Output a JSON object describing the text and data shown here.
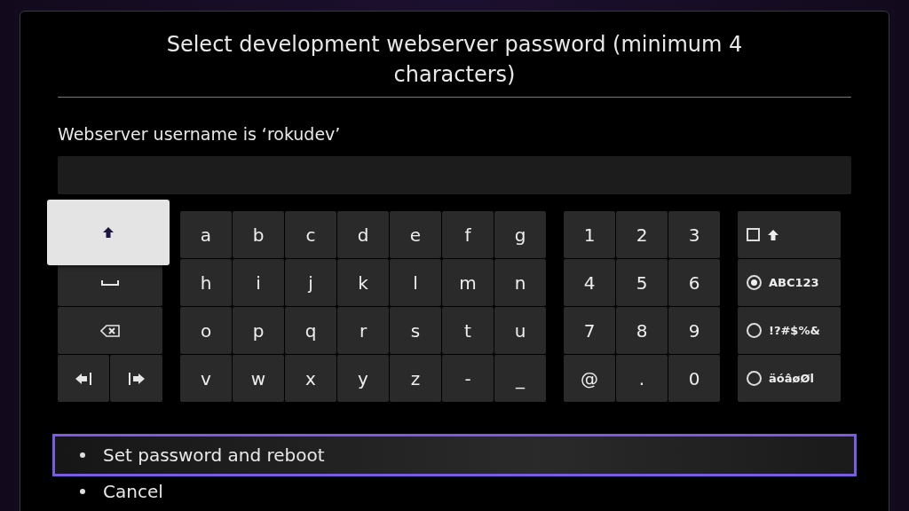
{
  "title": "Select development webserver password (minimum 4 characters)",
  "username_label": "Webserver username is ‘rokudev’",
  "special_keys": [
    {
      "kind": "shift",
      "focused": true
    },
    {
      "kind": "space",
      "focused": false
    },
    {
      "kind": "backspace",
      "focused": false
    },
    {
      "kind": "cursor_left",
      "focused": false
    },
    {
      "kind": "cursor_right",
      "focused": false
    }
  ],
  "letter_keys": [
    "a",
    "b",
    "c",
    "d",
    "e",
    "f",
    "g",
    "h",
    "i",
    "j",
    "k",
    "l",
    "m",
    "n",
    "o",
    "p",
    "q",
    "r",
    "s",
    "t",
    "u",
    "v",
    "w",
    "x",
    "y",
    "z",
    "-",
    "_"
  ],
  "number_keys": [
    "1",
    "2",
    "3",
    "4",
    "5",
    "6",
    "7",
    "8",
    "9",
    "@",
    ".",
    "0"
  ],
  "modes": [
    {
      "kind": "checkbox",
      "checked": false
    },
    {
      "kind": "radio",
      "label": "ABC123",
      "selected": true
    },
    {
      "kind": "radio",
      "label": "!?#$%&",
      "selected": false
    },
    {
      "kind": "radio",
      "label": "äóâøØl",
      "selected": false
    }
  ],
  "actions": [
    {
      "label": "Set password and reboot",
      "focused": true
    },
    {
      "label": "Cancel",
      "focused": false
    }
  ]
}
